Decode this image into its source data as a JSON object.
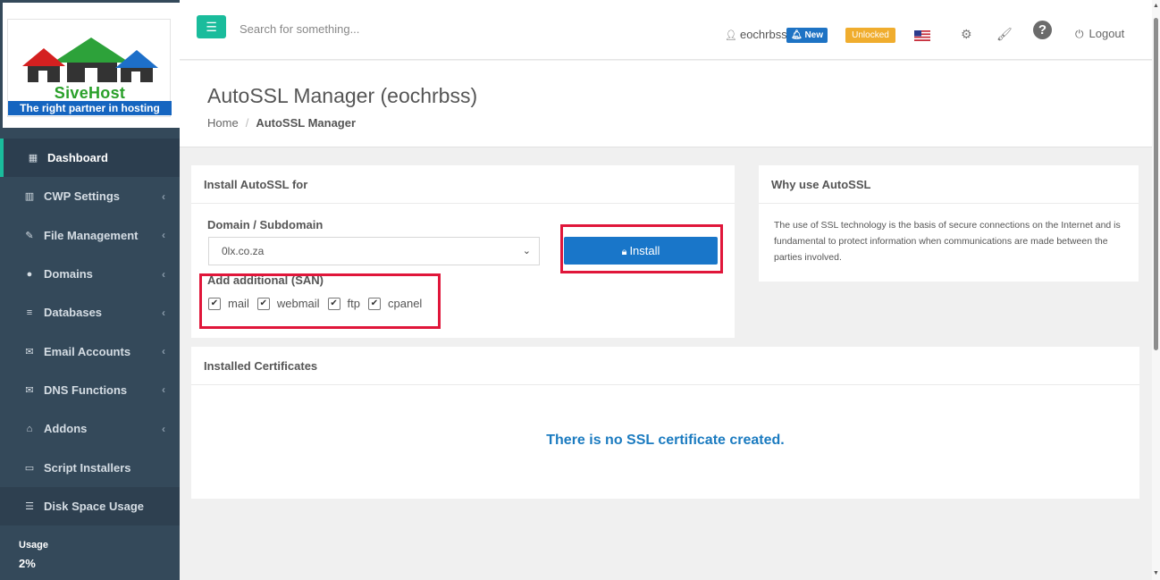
{
  "logo": {
    "name": "SiveHost",
    "tagline": "The right partner in hosting"
  },
  "sidebar": {
    "items": [
      {
        "label": "Dashboard",
        "icon": "dashboard-icon",
        "glyph": "▦",
        "chevron": ""
      },
      {
        "label": "CWP Settings",
        "icon": "bar-chart-icon",
        "glyph": "▥",
        "chevron": "‹"
      },
      {
        "label": "File Management",
        "icon": "edit-icon",
        "glyph": "✎",
        "chevron": "‹"
      },
      {
        "label": "Domains",
        "icon": "globe-icon",
        "glyph": "●",
        "chevron": "‹"
      },
      {
        "label": "Databases",
        "icon": "database-icon",
        "glyph": "≡",
        "chevron": "‹"
      },
      {
        "label": "Email Accounts",
        "icon": "envelope-icon",
        "glyph": "✉",
        "chevron": "‹"
      },
      {
        "label": "DNS Functions",
        "icon": "envelope-icon",
        "glyph": "✉",
        "chevron": "‹"
      },
      {
        "label": "Addons",
        "icon": "bank-icon",
        "glyph": "⌂",
        "chevron": "‹"
      },
      {
        "label": "Script Installers",
        "icon": "desktop-icon",
        "glyph": "▭",
        "chevron": ""
      },
      {
        "label": "Disk Space Usage",
        "icon": "server-icon",
        "glyph": "☰",
        "chevron": ""
      }
    ],
    "usage": {
      "label": "Usage",
      "value": "2%"
    }
  },
  "topbar": {
    "menu_glyph": "☰",
    "search_placeholder": "Search for something...",
    "username": "eochrbss",
    "new_badge": "New",
    "unlocked_badge": "Unlocked",
    "logout": "Logout",
    "help_glyph": "?"
  },
  "page": {
    "title": "AutoSSL Manager (eochrbss)",
    "breadcrumb": {
      "home": "Home",
      "separator": "/",
      "current": "AutoSSL Manager"
    }
  },
  "install_panel": {
    "header": "Install AutoSSL for",
    "domain_label": "Domain / Subdomain",
    "domain_selected": "0lx.co.za",
    "install_button": "Install",
    "san_label": "Add additional (SAN)",
    "san_options": [
      {
        "label": "mail",
        "checked": true
      },
      {
        "label": "webmail",
        "checked": true
      },
      {
        "label": "ftp",
        "checked": true
      },
      {
        "label": "cpanel",
        "checked": true
      }
    ]
  },
  "why_panel": {
    "header": "Why use AutoSSL",
    "text": "The use of SSL technology is the basis of secure connections on the Internet and is fundamental to protect information when communications are made between the parties involved."
  },
  "certs_panel": {
    "header": "Installed Certificates",
    "empty_message": "There is no SSL certificate created."
  },
  "colors": {
    "sidebar_bg": "#34495a",
    "accent": "#1abc9c",
    "primary": "#1976c9",
    "highlight": "#e0163a",
    "unlocked": "#f0ad2e"
  }
}
